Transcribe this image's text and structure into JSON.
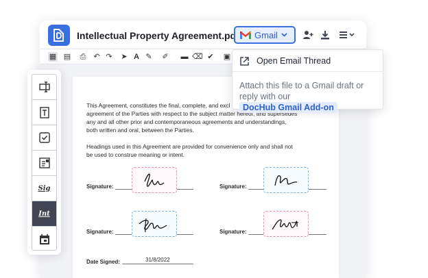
{
  "header": {
    "doc_title": "Intellectual Property Agreement.pdf",
    "gmail_label": "Gmail"
  },
  "popup": {
    "open_thread": "Open Email Thread",
    "desc_line1": "Attach this file to a Gmail draft or reply",
    "desc_prefix": "with our",
    "addon_link": "DocHub Gmail Add-on"
  },
  "document": {
    "para1": [
      "This Agreement, constitutes the final, complete, and excl",
      "agreement of the Parties with respect to the subject matter hereof, and supersedes",
      "any and all other prior and contemporaneous agreements and understandings,",
      "both written and oral, between the Parties."
    ],
    "para2": [
      "Headings used in this Agreement are provided for convenience only and shall not",
      "be used to construe meaning or intent."
    ],
    "signature_label": "Signature:",
    "date_label": "Date Signed:",
    "date_value": "31/8/2022"
  },
  "sidebar": {
    "sig_text": "Sig",
    "init_text": "Int"
  },
  "colors": {
    "accent": "#3a6fe0",
    "sidebar_active": "#3f4552",
    "sig_pink": "#ee8fa6",
    "sig_blue": "#77b6e8"
  }
}
